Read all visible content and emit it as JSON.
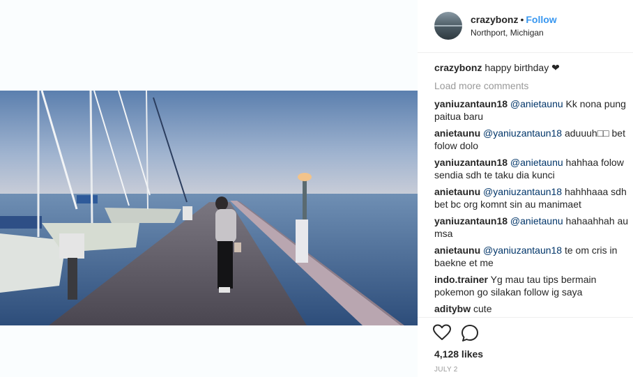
{
  "post": {
    "username": "crazybonz",
    "separator": "•",
    "follow_label": "Follow",
    "location": "Northport, Michigan"
  },
  "caption": {
    "author": "crazybonz",
    "text": "happy birthday ❤"
  },
  "load_more_label": "Load more comments",
  "comments": [
    {
      "author": "yaniuzantaun18",
      "mention": "@anietaunu",
      "text": "Kk nona pung paitua baru"
    },
    {
      "author": "anietaunu",
      "mention": "@yaniuzantaun18",
      "text": "aduuuh□□ bet folow dolo"
    },
    {
      "author": "yaniuzantaun18",
      "mention": "@anietaunu",
      "text": "hahhaa folow sendia sdh te taku dia kunci"
    },
    {
      "author": "anietaunu",
      "mention": "@yaniuzantaun18",
      "text": "hahhhaaa sdh bet bc org komnt sin au manimaet"
    },
    {
      "author": "yaniuzantaun18",
      "mention": "@anietaunu",
      "text": "hahaahhah au msa"
    },
    {
      "author": "anietaunu",
      "mention": "@yaniuzantaun18",
      "text": "te om cris in baekne et me"
    },
    {
      "author": "indo.trainer",
      "mention": "",
      "text": "Yg mau tau tips bermain pokemon go silakan follow ig saya"
    },
    {
      "author": "aditybw",
      "mention": "",
      "text": "cute"
    }
  ],
  "actions": {
    "like_icon": "heart-outline-icon",
    "comment_icon": "comment-bubble-icon"
  },
  "likes_label": "4,128 likes",
  "date_label": "JULY 2",
  "colors": {
    "follow": "#3897f0",
    "muted": "#999999",
    "mention": "#003569"
  }
}
